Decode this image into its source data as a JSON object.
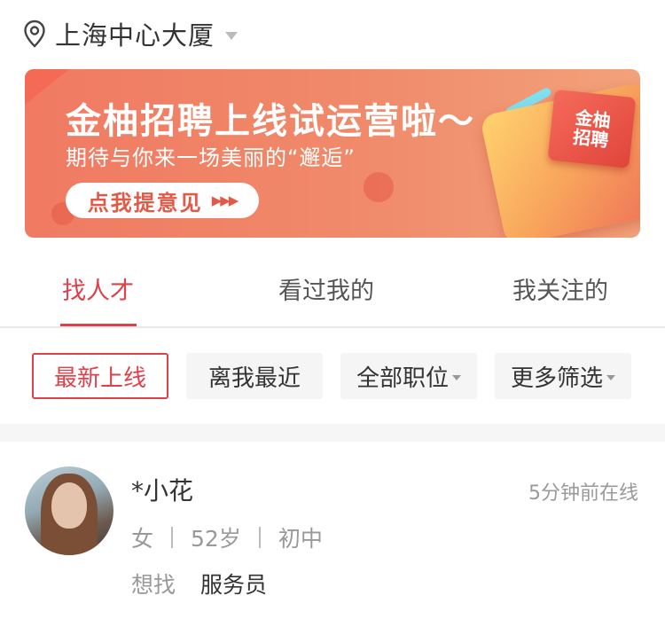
{
  "location": {
    "text": "上海中心大厦",
    "icon": "location-pin-icon",
    "dropdown_icon": "caret-down-icon"
  },
  "banner": {
    "title": "金柚招聘上线试运营啦～",
    "subtitle": "期待与你来一场美丽的“邂逅”",
    "button_label": "点我提意见",
    "button_arrows": "▶▶▶",
    "card_text": "金柚招聘",
    "colors": {
      "background": "#f07a62",
      "accent": "#e25a47"
    }
  },
  "tabs": {
    "items": [
      {
        "label": "找人才",
        "active": true
      },
      {
        "label": "看过我的",
        "active": false
      },
      {
        "label": "我关注的",
        "active": false
      }
    ],
    "active_color": "#e0404a"
  },
  "filters": {
    "items": [
      {
        "label": "最新上线",
        "active": true,
        "dropdown": false
      },
      {
        "label": "离我最近",
        "active": false,
        "dropdown": false
      },
      {
        "label": "全部职位",
        "active": false,
        "dropdown": true
      },
      {
        "label": "更多筛选",
        "active": false,
        "dropdown": true
      }
    ]
  },
  "candidates": [
    {
      "name": "*小花",
      "online_status": "5分钟前在线",
      "gender": "女",
      "age": "52岁",
      "education": "初中",
      "want_label": "想找",
      "want_position": "服务员"
    }
  ]
}
